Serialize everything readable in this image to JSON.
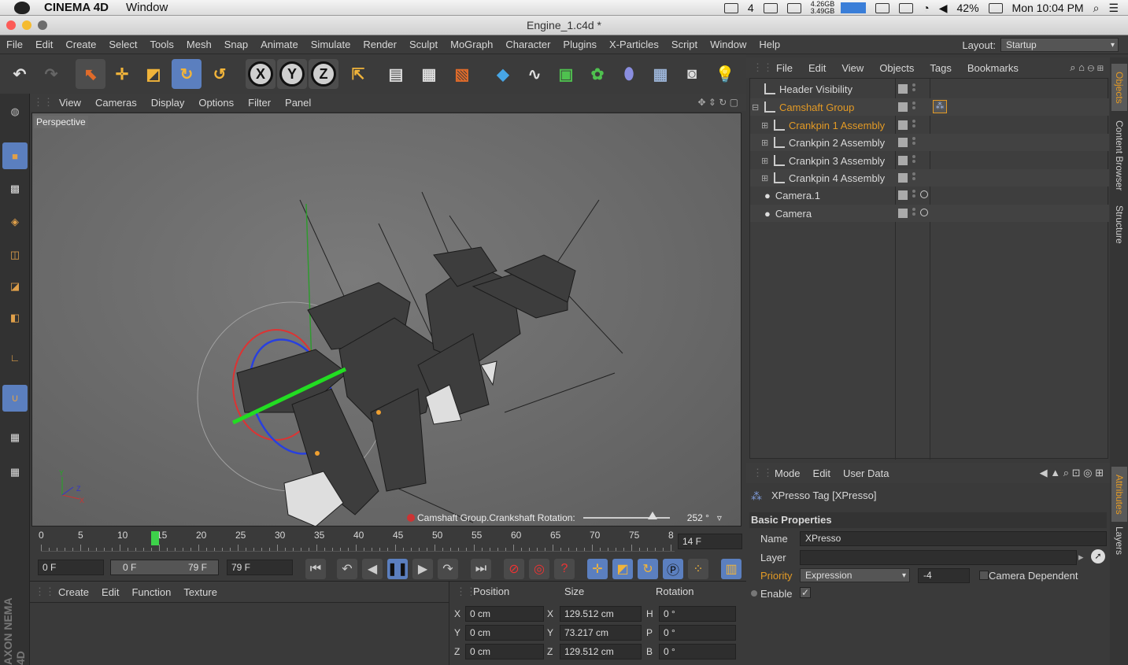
{
  "macbar": {
    "app_name": "CINEMA 4D",
    "menu_window": "Window",
    "tray_count": "4",
    "memory_top": "4.26GB",
    "memory_bottom": "3.49GB",
    "battery": "42%",
    "clock": "Mon 10:04 PM"
  },
  "window": {
    "title": "Engine_1.c4d *"
  },
  "appmenu": {
    "items": [
      "File",
      "Edit",
      "Create",
      "Select",
      "Tools",
      "Mesh",
      "Snap",
      "Animate",
      "Simulate",
      "Render",
      "Sculpt",
      "MoGraph",
      "Character",
      "Plugins",
      "X-Particles",
      "Script",
      "Window",
      "Help"
    ],
    "layout_label": "Layout:",
    "layout_value": "Startup"
  },
  "toolbar": {
    "axis_x": "X",
    "axis_y": "Y",
    "axis_z": "Z",
    "icons": [
      "undo-icon",
      "redo-icon",
      "live-select-icon",
      "move-icon",
      "scale-icon",
      "rotate-icon",
      "recent-tool-icon",
      "lock-x-icon",
      "lock-y-icon",
      "lock-z-icon",
      "coordinate-system-icon",
      "render-view-icon",
      "render-picture-viewer-icon",
      "edit-render-settings-icon",
      "cube-icon",
      "spline-pen-icon",
      "subdivision-icon",
      "cloner-icon",
      "deformer-icon",
      "floor-icon",
      "camera-icon",
      "light-icon"
    ]
  },
  "viewport": {
    "menu": [
      "View",
      "Cameras",
      "Display",
      "Options",
      "Filter",
      "Panel"
    ],
    "label": "Perspective",
    "hud_text": "Camshaft Group.Crankshaft Rotation:",
    "hud_value": "252 °",
    "hud_slider_fraction": 0.8
  },
  "timeline": {
    "ticks": [
      "0",
      "5",
      "10",
      "15",
      "20",
      "25",
      "30",
      "35",
      "40",
      "45",
      "50",
      "55",
      "60",
      "65",
      "70",
      "75",
      "8"
    ],
    "current_frame_field": "14 F",
    "current_frame": 14
  },
  "transport": {
    "start_field": "0 F",
    "range_start": "0 F",
    "range_end": "79 F",
    "end_field": "79 F"
  },
  "material": {
    "menu": [
      "Create",
      "Edit",
      "Function",
      "Texture"
    ]
  },
  "coordinates": {
    "headers": [
      "Position",
      "Size",
      "Rotation"
    ],
    "rows": [
      {
        "axis": "X",
        "pos": "0 cm",
        "size_axis": "X",
        "size": "129.512 cm",
        "rot_axis": "H",
        "rot": "0 °"
      },
      {
        "axis": "Y",
        "pos": "0 cm",
        "size_axis": "Y",
        "size": "73.217 cm",
        "rot_axis": "P",
        "rot": "0 °"
      },
      {
        "axis": "Z",
        "pos": "0 cm",
        "size_axis": "Z",
        "size": "129.512 cm",
        "rot_axis": "B",
        "rot": "0 °"
      }
    ]
  },
  "objects": {
    "menu": [
      "File",
      "Edit",
      "View",
      "Objects",
      "Tags",
      "Bookmarks"
    ],
    "items": [
      {
        "name": "Header Visibility",
        "level": 0,
        "color": "#d8d8d8"
      },
      {
        "name": "Camshaft Group",
        "level": 0,
        "color": "#e39a25"
      },
      {
        "name": "Crankpin 1 Assembly",
        "level": 1,
        "color": "#e39a25"
      },
      {
        "name": "Crankpin 2 Assembly",
        "level": 1,
        "color": "#d8d8d8"
      },
      {
        "name": "Crankpin 3 Assembly",
        "level": 1,
        "color": "#d8d8d8"
      },
      {
        "name": "Crankpin 4 Assembly",
        "level": 1,
        "color": "#d8d8d8"
      },
      {
        "name": "Camera.1",
        "level": 0,
        "color": "#d8d8d8"
      },
      {
        "name": "Camera",
        "level": 0,
        "color": "#d8d8d8"
      }
    ]
  },
  "sidetabs": {
    "objects": "Objects",
    "content_browser": "Content Browser",
    "structure": "Structure",
    "attributes": "Attributes",
    "layers": "Layers"
  },
  "attributes": {
    "menu": [
      "Mode",
      "Edit",
      "User Data"
    ],
    "tag_title": "XPresso Tag [XPresso]",
    "section": "Basic Properties",
    "name_label": "Name",
    "name_value": "XPresso",
    "layer_label": "Layer",
    "layer_value": "",
    "priority_label": "Priority",
    "priority_value": "Expression",
    "priority_num": "-4",
    "camera_dependent_label": "Camera Dependent",
    "enable_label": "Enable",
    "enable_check": "✓"
  },
  "branding": {
    "vertical": "AXON NEMA 4D"
  },
  "colors": {
    "accent": "#e39a25",
    "selection": "#5b7fbf",
    "panel": "#3a3a3a"
  }
}
